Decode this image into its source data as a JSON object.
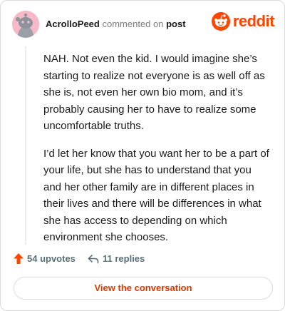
{
  "header": {
    "username": "AcrolloPeed",
    "action": "commented on",
    "target": "post",
    "brand": "reddit",
    "avatar_color": "#f7b9c7",
    "brand_color": "#ff4500"
  },
  "comment": {
    "paragraphs": [
      "NAH. Not even the kid. I would imagine she’s starting to realize not everyone is as well off as she is, not even her own bio mom, and it’s probably causing her to have to realize some uncomfortable truths.",
      "I’d let her know that you want her to be a part of your life, but she has to understand that you and her other family are in different places in their lives and there will be differences in what she has access to depending on which environment she chooses."
    ]
  },
  "stats": {
    "upvotes": "54 upvotes",
    "replies": "11 replies",
    "upvote_icon": "arrow-up-icon",
    "reply_icon": "reply-arrow-icon"
  },
  "cta": {
    "label": "View the conversation",
    "color": "#d93a00"
  }
}
